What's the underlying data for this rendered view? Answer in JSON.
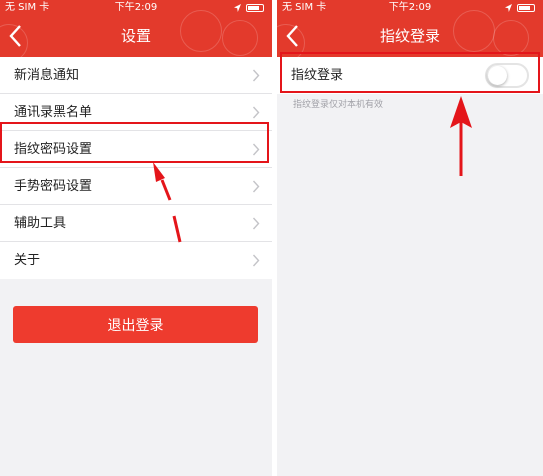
{
  "status_bar": {
    "carrier": "无 SIM 卡",
    "time": "下午2:09"
  },
  "settings_screen": {
    "title": "设置",
    "items": [
      {
        "label": "新消息通知"
      },
      {
        "label": "通讯录黑名单"
      },
      {
        "label": "指纹密码设置"
      },
      {
        "label": "手势密码设置"
      },
      {
        "label": "辅助工具"
      },
      {
        "label": "关于"
      }
    ],
    "logout_label": "退出登录"
  },
  "fingerprint_screen": {
    "title": "指纹登录",
    "toggle_label": "指纹登录",
    "toggle_on": false,
    "hint": "指纹登录仅对本机有效"
  },
  "colors": {
    "nav_red": "#e33a2c",
    "button_red": "#ee3b2e",
    "highlight_red": "#e4151a"
  }
}
